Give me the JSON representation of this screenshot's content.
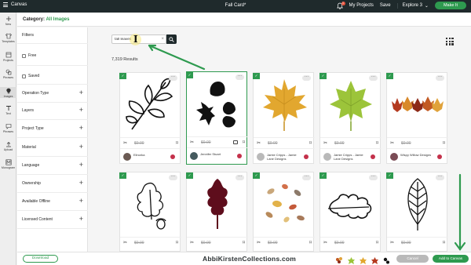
{
  "topbar": {
    "app_label": "Canvas",
    "doc_title": "Fall Card*",
    "notification_count": "1",
    "my_projects": "My Projects",
    "save": "Save",
    "machine": "Explore 3",
    "make_it": "Make It"
  },
  "rail": {
    "items": [
      "New",
      "Templates",
      "Projects",
      "Phrases",
      "Images",
      "Text",
      "Phrases",
      "Upload",
      "Monogram"
    ]
  },
  "category": {
    "prefix": "Category:",
    "value": "All Images"
  },
  "filters": {
    "title": "Filters",
    "checks": [
      "Free",
      "Saved"
    ],
    "sections": [
      "Operation Type",
      "Layers",
      "Project Type",
      "Material",
      "Language",
      "Ownership",
      "Available Offline",
      "Licensed Content"
    ]
  },
  "search": {
    "value": "fall leaves"
  },
  "results": "7,319 Results",
  "cards_row1": [
    {
      "price": "$0.00",
      "author": "Elinorka"
    },
    {
      "price": "$0.00",
      "author": "Jennifer Stuart"
    },
    {
      "price": "$0.00",
      "author": "Jamie Cripps - Jamie Lane Designs"
    },
    {
      "price": "$0.00",
      "author": "Jamie Cripps - Jamie Lane Designs"
    },
    {
      "price": "$0.00",
      "author": "Wispy Willow Designs"
    }
  ],
  "cards_row2": [
    {
      "price": "$0.00"
    },
    {
      "price": "$0.00"
    },
    {
      "price": "$0.00"
    },
    {
      "price": "$0.00"
    },
    {
      "price": "$0.00"
    }
  ],
  "bottombar": {
    "download": "Download",
    "brand": "AbbiKirstenCollections.com",
    "cancel": "Cancel",
    "add_to_canvas": "Add to Canvas"
  },
  "colors": {
    "accent": "#2e9a4f",
    "topbar": "#1f2a2c",
    "arrow": "#2e9a4f"
  }
}
